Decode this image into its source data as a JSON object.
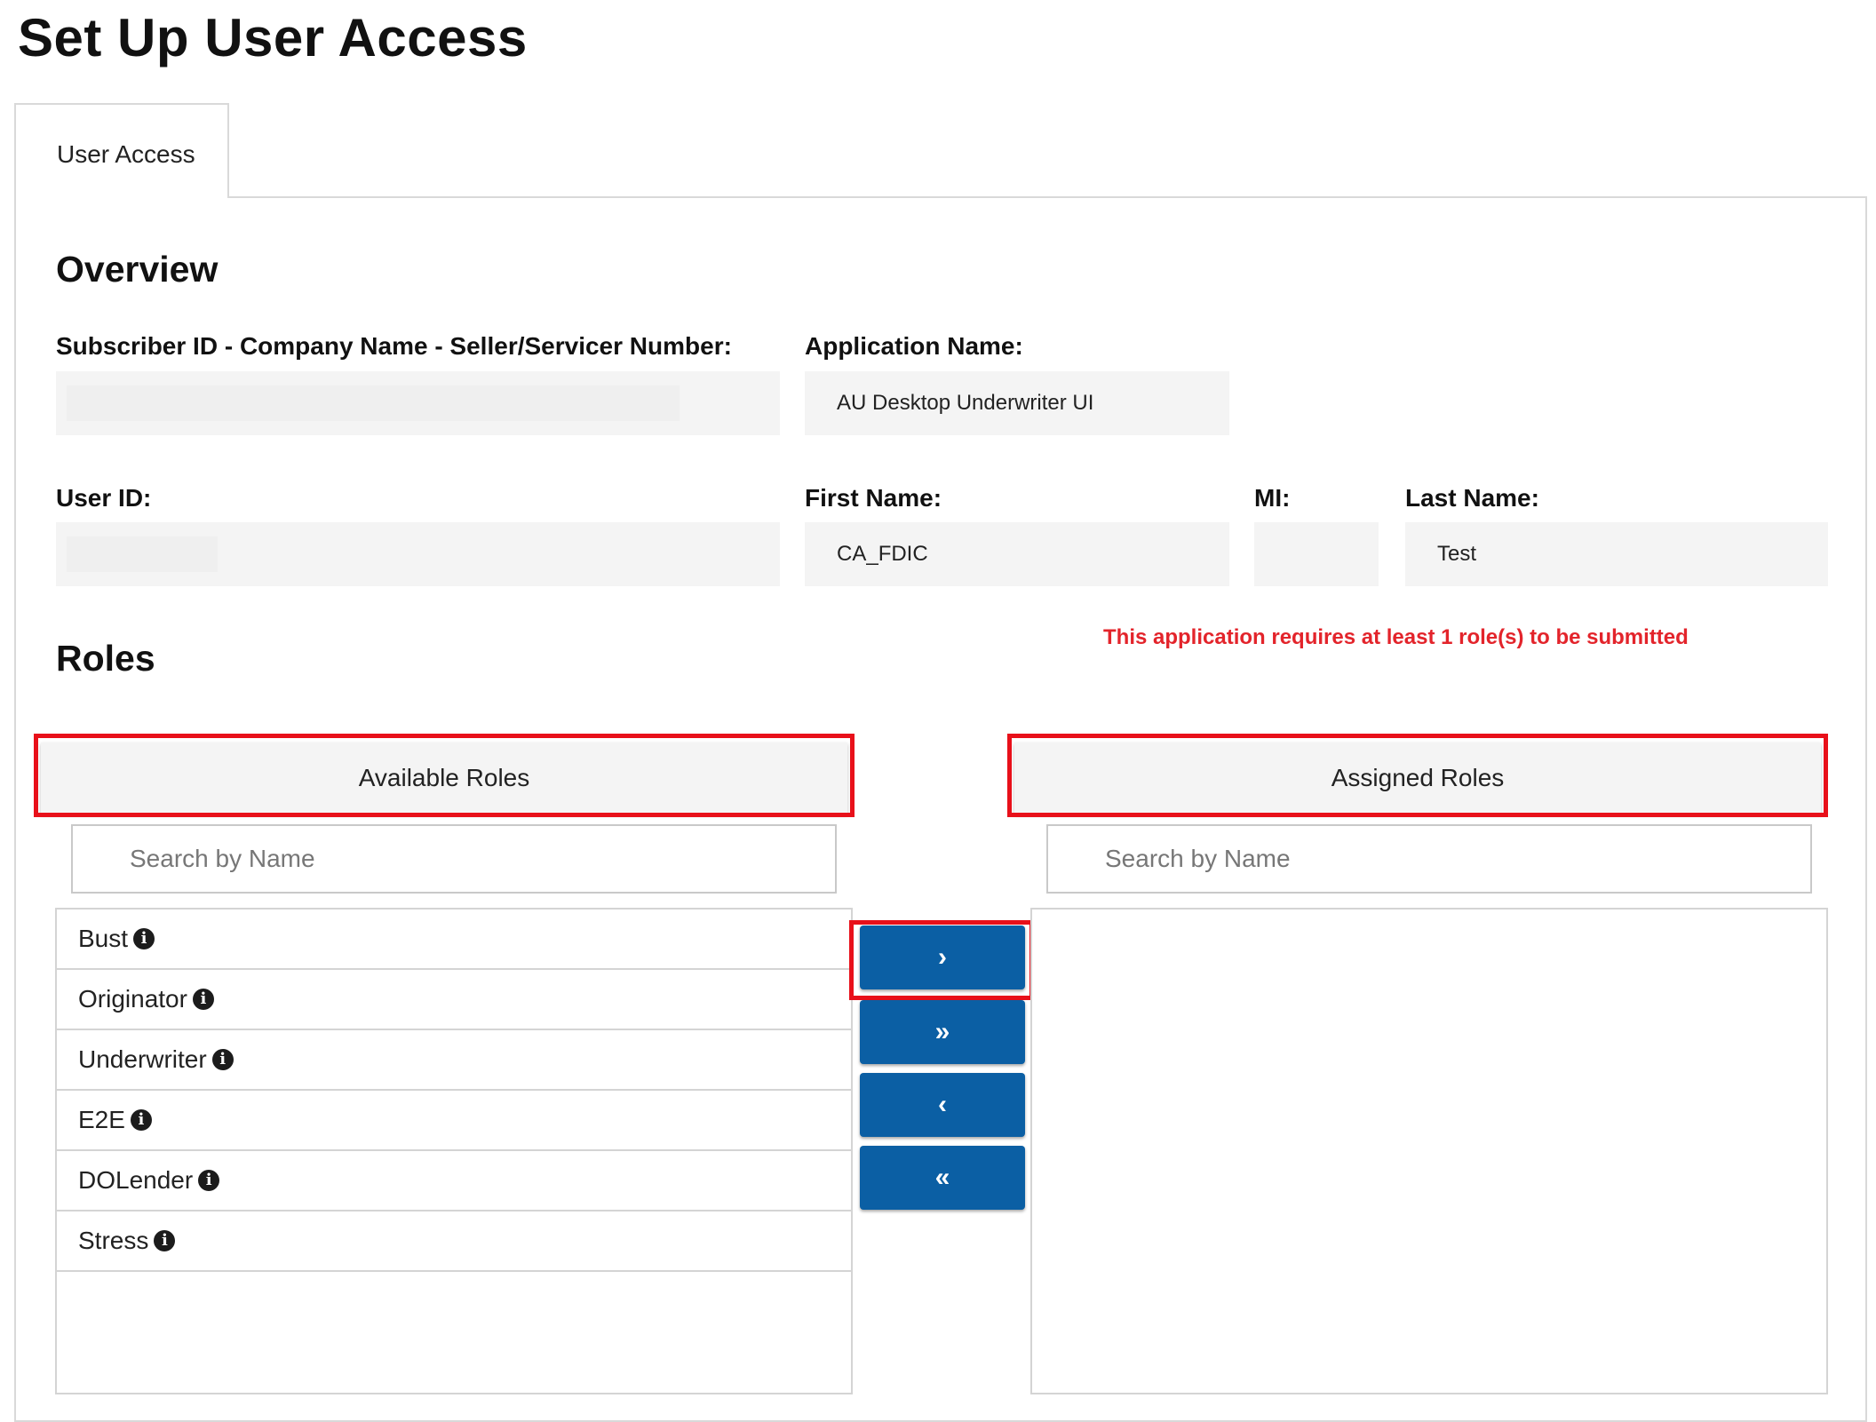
{
  "page": {
    "title": "Set Up User Access"
  },
  "tabs": [
    {
      "label": "User Access"
    }
  ],
  "overview": {
    "heading": "Overview",
    "subscriber_label": "Subscriber ID - Company Name - Seller/Servicer Number:",
    "subscriber_value": "",
    "application_label": "Application Name:",
    "application_value": "AU Desktop Underwriter UI",
    "user_id_label": "User ID:",
    "user_id_value": "",
    "first_name_label": "First Name:",
    "first_name_value": "CA_FDIC",
    "mi_label": "MI:",
    "mi_value": "",
    "last_name_label": "Last Name:",
    "last_name_value": "Test"
  },
  "roles": {
    "heading": "Roles",
    "notice": "This application requires at least 1 role(s) to be submitted",
    "available": {
      "header": "Available Roles",
      "search_placeholder": "Search by Name",
      "items": [
        "Bust",
        "Originator",
        "Underwriter",
        "E2E",
        "DOLender",
        "Stress"
      ]
    },
    "assigned": {
      "header": "Assigned Roles",
      "search_placeholder": "Search by Name",
      "items": []
    },
    "buttons": {
      "move_right": "›",
      "move_all_right": "»",
      "move_left": "‹",
      "move_all_left": "«"
    }
  },
  "colors": {
    "accent_button": "#0b5fa4",
    "highlight_box": "#e8101a",
    "notice_text": "#e3242b",
    "field_bg": "#f4f4f4"
  },
  "icons": {
    "role_info": "info-circle-icon"
  }
}
